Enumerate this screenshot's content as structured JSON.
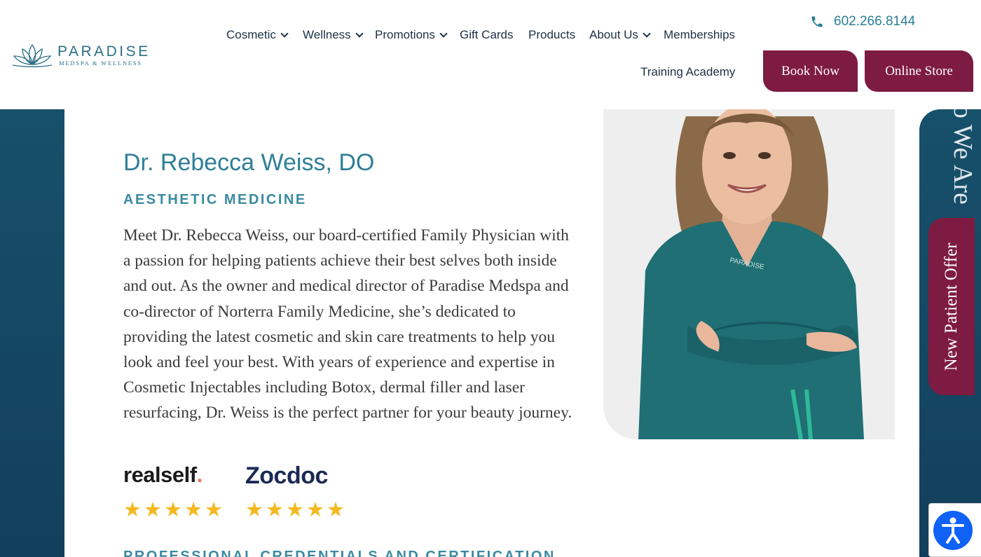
{
  "brand": {
    "name": "PARADISE",
    "tagline": "MEDSPA & WELLNESS",
    "logo_icon": "lotus-icon"
  },
  "header": {
    "phone": "602.266.8144",
    "phone_icon": "phone-icon",
    "nav": [
      {
        "label": "Cosmetic",
        "has_dropdown": true
      },
      {
        "label": "Wellness",
        "has_dropdown": true
      },
      {
        "label": "Promotions",
        "has_dropdown": true
      },
      {
        "label": "Gift Cards",
        "has_dropdown": false
      },
      {
        "label": "Products",
        "has_dropdown": false
      },
      {
        "label": "About Us",
        "has_dropdown": true
      },
      {
        "label": "Memberships",
        "has_dropdown": false
      },
      {
        "label": "Training Academy",
        "has_dropdown": false
      }
    ],
    "book_now": "Book Now",
    "online_store": "Online Store"
  },
  "side": {
    "vertical_text": "o We Are",
    "offer_tab": "New Patient Offer"
  },
  "profile": {
    "name": "Dr. Rebecca Weiss, DO",
    "specialty": "AESTHETIC MEDICINE",
    "bio": "Meet Dr. Rebecca Weiss, our board-certified Family Physician with a passion for helping patients achieve their best selves both inside and out. As the owner and medical director of Paradise Medspa and co-director of Norterra Family Medicine, she’s dedicated to providing the latest cosmetic and skin care treatments to help you look and feel your best. With years of experience and expertise in Cosmetic Injectables including Botox, dermal filler and laser resurfacing, Dr. Weiss is the perfect partner for your beauty journey.",
    "next_section": "PROFESSIONAL CREDENTIALS AND CERTIFICATION"
  },
  "reviews": [
    {
      "site": "realself",
      "dot": ".",
      "rating": 5,
      "stars": "★★★★★"
    },
    {
      "site": "Zocdoc",
      "rating": 5,
      "stars": "★★★★★"
    }
  ],
  "colors": {
    "brand_teal": "#2e7f96",
    "brand_burgundy": "#7e1b42",
    "navy_background": "#17506a",
    "star_gold": "#f5b820"
  },
  "accessibility_icon": "accessibility-icon"
}
